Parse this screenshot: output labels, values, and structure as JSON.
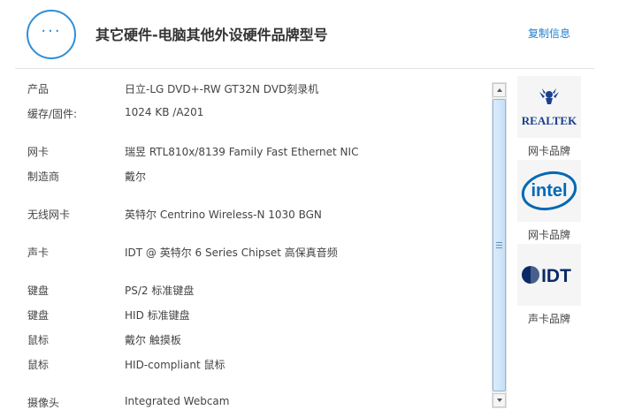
{
  "header": {
    "icon": "more-dots-icon",
    "icon_glyph": "···",
    "title": "其它硬件-电脑其他外设硬件品牌型号",
    "copy_label": "复制信息"
  },
  "rows": [
    {
      "label": "产品",
      "value": "日立-LG DVD+-RW GT32N DVD刻录机"
    },
    {
      "label": "缓存/固件:",
      "value": "1024 KB /A201"
    },
    {
      "label": "网卡",
      "value": "瑞昱 RTL810x/8139 Family Fast Ethernet NIC"
    },
    {
      "label": "制造商",
      "value": "戴尔"
    },
    {
      "label": "无线网卡",
      "value": "英特尔 Centrino Wireless-N 1030 BGN"
    },
    {
      "label": "声卡",
      "value": "IDT  @ 英特尔 6 Series Chipset  高保真音频"
    },
    {
      "label": "键盘",
      "value": "PS/2 标准键盘"
    },
    {
      "label": "键盘",
      "value": "HID 标准键盘"
    },
    {
      "label": "鼠标",
      "value": "戴尔 触摸板"
    },
    {
      "label": "鼠标",
      "value": "HID-compliant 鼠标"
    },
    {
      "label": "摄像头",
      "value": "Integrated Webcam"
    }
  ],
  "brands": [
    {
      "logo_text": "REALTEK",
      "caption": "网卡品牌",
      "color": "#1b3f8f"
    },
    {
      "logo_text": "intel",
      "caption": "网卡品牌",
      "color": "#0068b5"
    },
    {
      "logo_text": "IDT",
      "caption": "声卡品牌",
      "color": "#0a2a66"
    }
  ],
  "colors": {
    "accent": "#2f8fd8",
    "link": "#1f7fd0"
  }
}
